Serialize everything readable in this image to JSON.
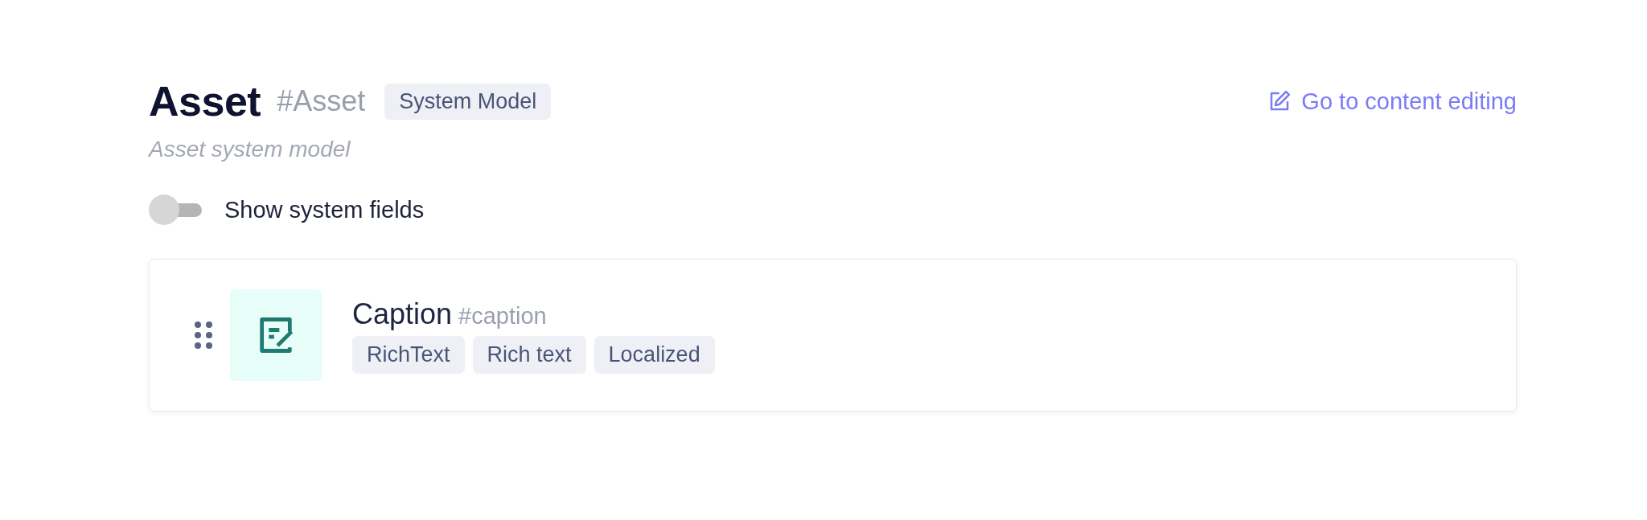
{
  "header": {
    "title": "Asset",
    "api_id": "#Asset",
    "badge": "System Model",
    "description": "Asset system model",
    "link": "Go to content editing"
  },
  "system_fields_toggle": {
    "label": "Show system fields",
    "on": false
  },
  "fields": [
    {
      "name": "Caption",
      "api_id": "#caption",
      "tags": [
        "RichText",
        "Rich text",
        "Localized"
      ]
    }
  ]
}
